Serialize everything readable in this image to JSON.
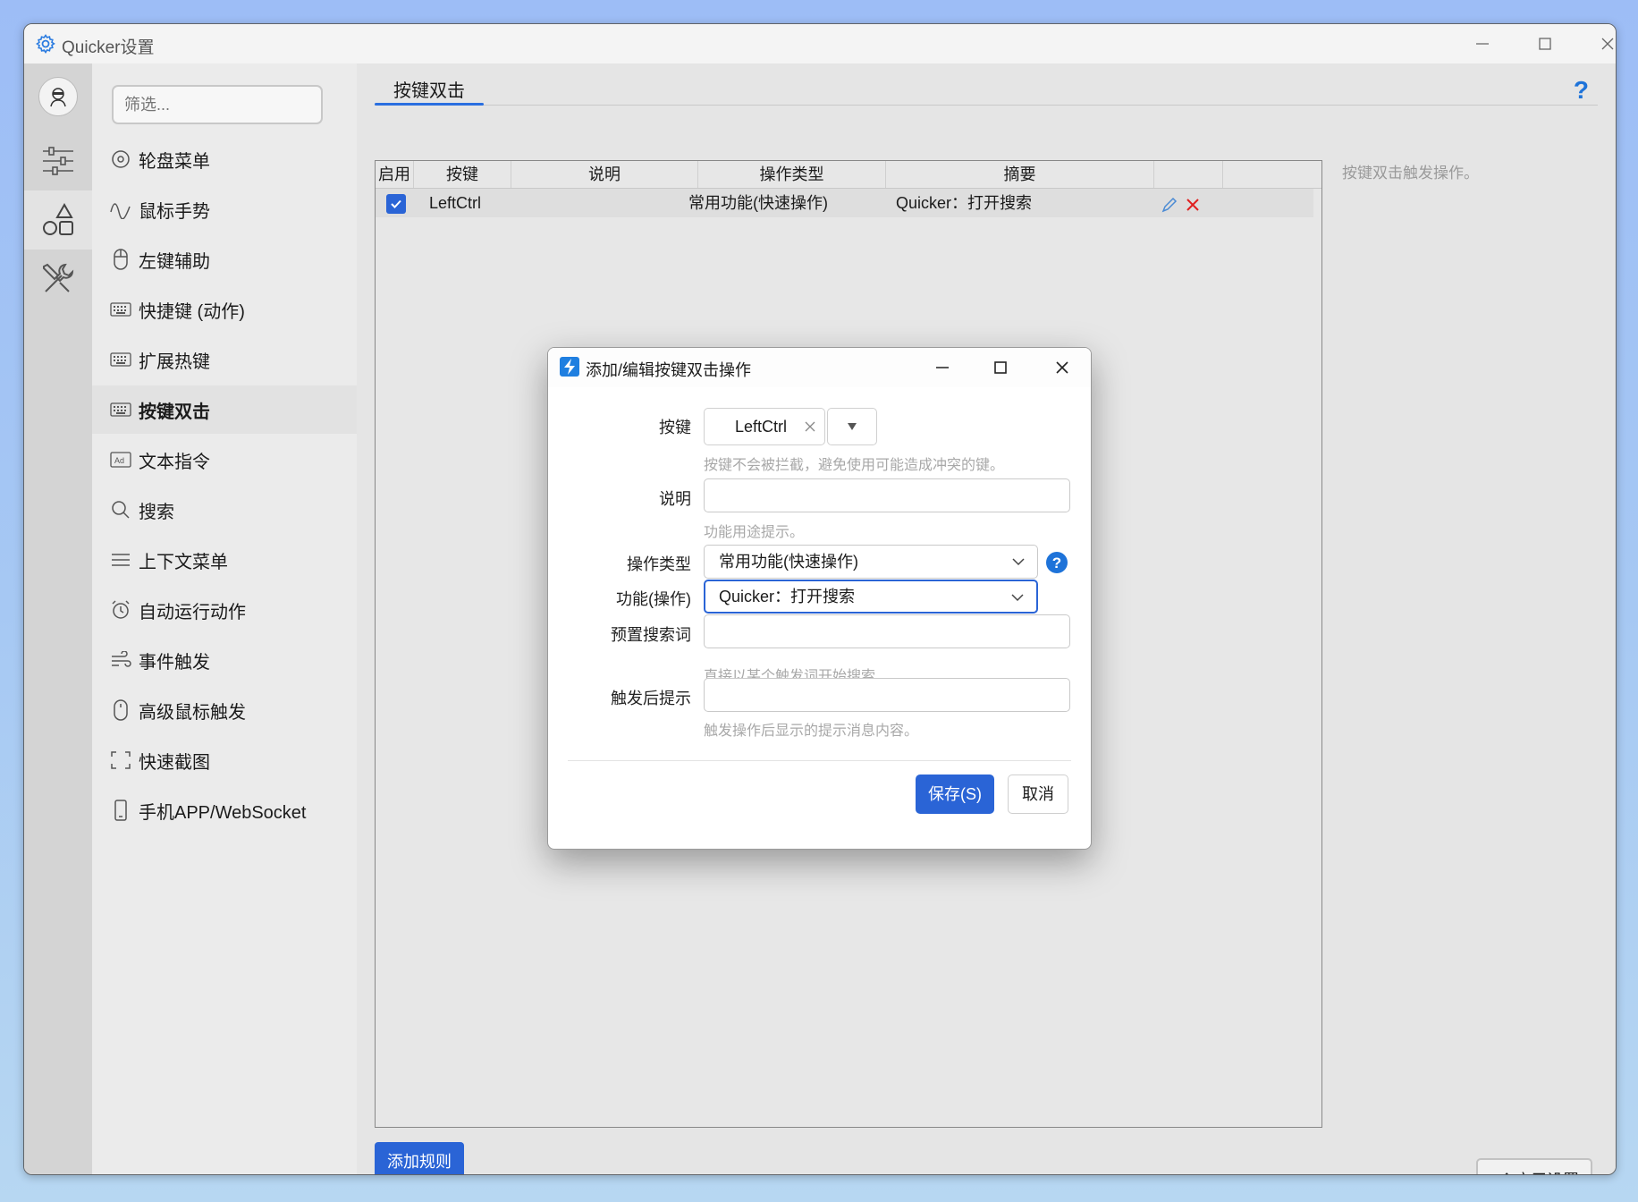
{
  "window": {
    "title": "Quicker设置",
    "app_icon": "gear-icon",
    "controls": [
      "minimize-icon",
      "maximize-icon",
      "close-icon"
    ]
  },
  "iconbar": {
    "items": [
      "avatar",
      "sliders-icon",
      "shapes-icon",
      "tools-icon"
    ]
  },
  "sidebar": {
    "filter_placeholder": "筛选...",
    "items": [
      {
        "label": "轮盘菜单",
        "icon": "wheel-icon"
      },
      {
        "label": "鼠标手势",
        "icon": "gesture-icon"
      },
      {
        "label": "左键辅助",
        "icon": "mouse-icon"
      },
      {
        "label": "快捷键 (动作)",
        "icon": "keyboard-icon"
      },
      {
        "label": "扩展热键",
        "icon": "keyboard-icon"
      },
      {
        "label": "按键双击",
        "icon": "keyboard-icon",
        "active": true
      },
      {
        "label": "文本指令",
        "icon": "ad-icon"
      },
      {
        "label": "搜索",
        "icon": "search-icon"
      },
      {
        "label": "上下文菜单",
        "icon": "menu-icon"
      },
      {
        "label": "自动运行动作",
        "icon": "alarm-icon"
      },
      {
        "label": "事件触发",
        "icon": "wind-icon"
      },
      {
        "label": "高级鼠标触发",
        "icon": "mouse-icon"
      },
      {
        "label": "快速截图",
        "icon": "screenshot-icon"
      },
      {
        "label": "手机APP/WebSocket",
        "icon": "phone-icon"
      }
    ]
  },
  "main": {
    "tab_label": "按键双击",
    "help_label": "?",
    "hint_text": "按键双击触发操作。",
    "add_button": "添加规则",
    "apply_button": "应用设置",
    "table": {
      "columns": [
        "启用",
        "按键",
        "说明",
        "操作类型",
        "摘要"
      ],
      "rows": [
        {
          "enabled": true,
          "key": "LeftCtrl",
          "desc": "",
          "type": "常用功能(快速操作)",
          "summary": "Quicker：打开搜索"
        }
      ]
    }
  },
  "dialog": {
    "title": "添加/编辑按键双击操作",
    "key_label": "按键",
    "key_value": "LeftCtrl",
    "key_hint": "按键不会被拦截，避免使用可能造成冲突的键。",
    "desc_label": "说明",
    "desc_value": "",
    "desc_hint": "功能用途提示。",
    "type_label": "操作类型",
    "type_value": "常用功能(快速操作)",
    "func_label": "功能(操作)",
    "func_value": "Quicker：打开搜索",
    "preset_label": "预置搜索词",
    "preset_value": "",
    "preset_hint": "直接以某个触发词开始搜索",
    "notify_label": "触发后提示",
    "notify_value": "",
    "notify_hint": "触发操作后显示的提示消息内容。",
    "save_button": "保存(S)",
    "cancel_button": "取消"
  },
  "colors": {
    "accent": "#2a64d6",
    "help_blue": "#1e73d9",
    "delete_red": "#e02020"
  }
}
